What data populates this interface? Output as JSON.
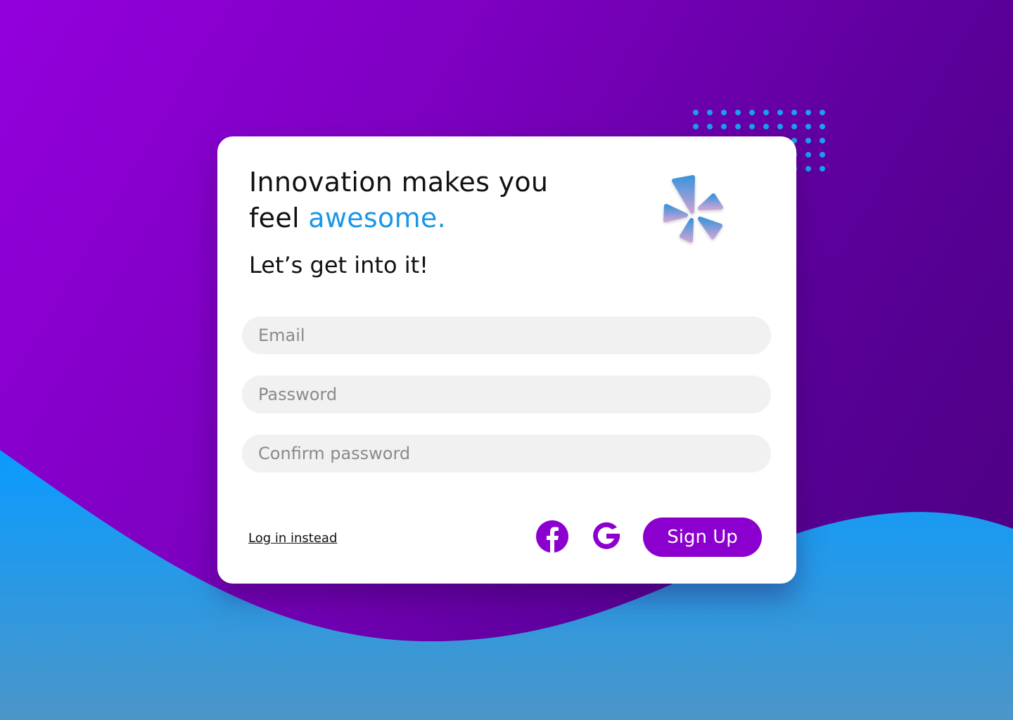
{
  "headline": {
    "line1": "Innovation makes you",
    "line2_prefix": "feel ",
    "line2_accent": "awesome."
  },
  "subtitle": "Let’s get into it!",
  "form": {
    "email_placeholder": "Email",
    "password_placeholder": "Password",
    "confirm_placeholder": "Confirm password"
  },
  "footer": {
    "login_link": "Log in instead",
    "signup_label": "Sign Up"
  },
  "icons": {
    "logo": "yelp-burst-icon",
    "facebook": "facebook-icon",
    "google": "google-icon"
  },
  "colors": {
    "primary": "#8c00cf",
    "accent": "#1a96e8",
    "wave": "#1a9af0",
    "field": "#f1f1f1"
  }
}
